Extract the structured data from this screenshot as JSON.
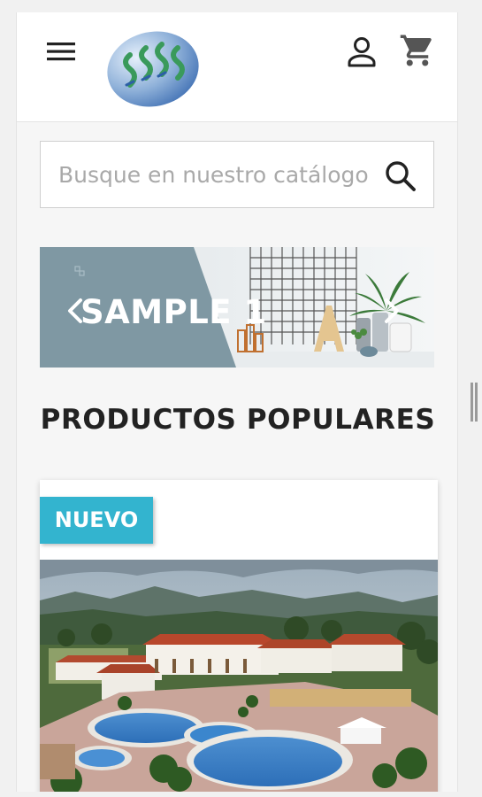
{
  "colors": {
    "accent": "#33b4cf",
    "banner_slate": "#7f98a3",
    "icon_dark": "#222222",
    "cart_grey": "#555555"
  },
  "header": {
    "menu_icon": "hamburger-menu-icon",
    "logo": "brand-logo",
    "account_icon": "user-account-icon",
    "cart_icon": "shopping-cart-icon"
  },
  "search": {
    "placeholder": "Busque en nuestro catálogo",
    "value": "",
    "icon": "search-icon"
  },
  "slider": {
    "slide_title": "SAMPLE 1",
    "prev_icon": "chevron-left-icon",
    "next_icon": "chevron-right-icon"
  },
  "section": {
    "title": "PRODUCTOS POPULARES"
  },
  "product": {
    "badge": "NUEVO"
  }
}
